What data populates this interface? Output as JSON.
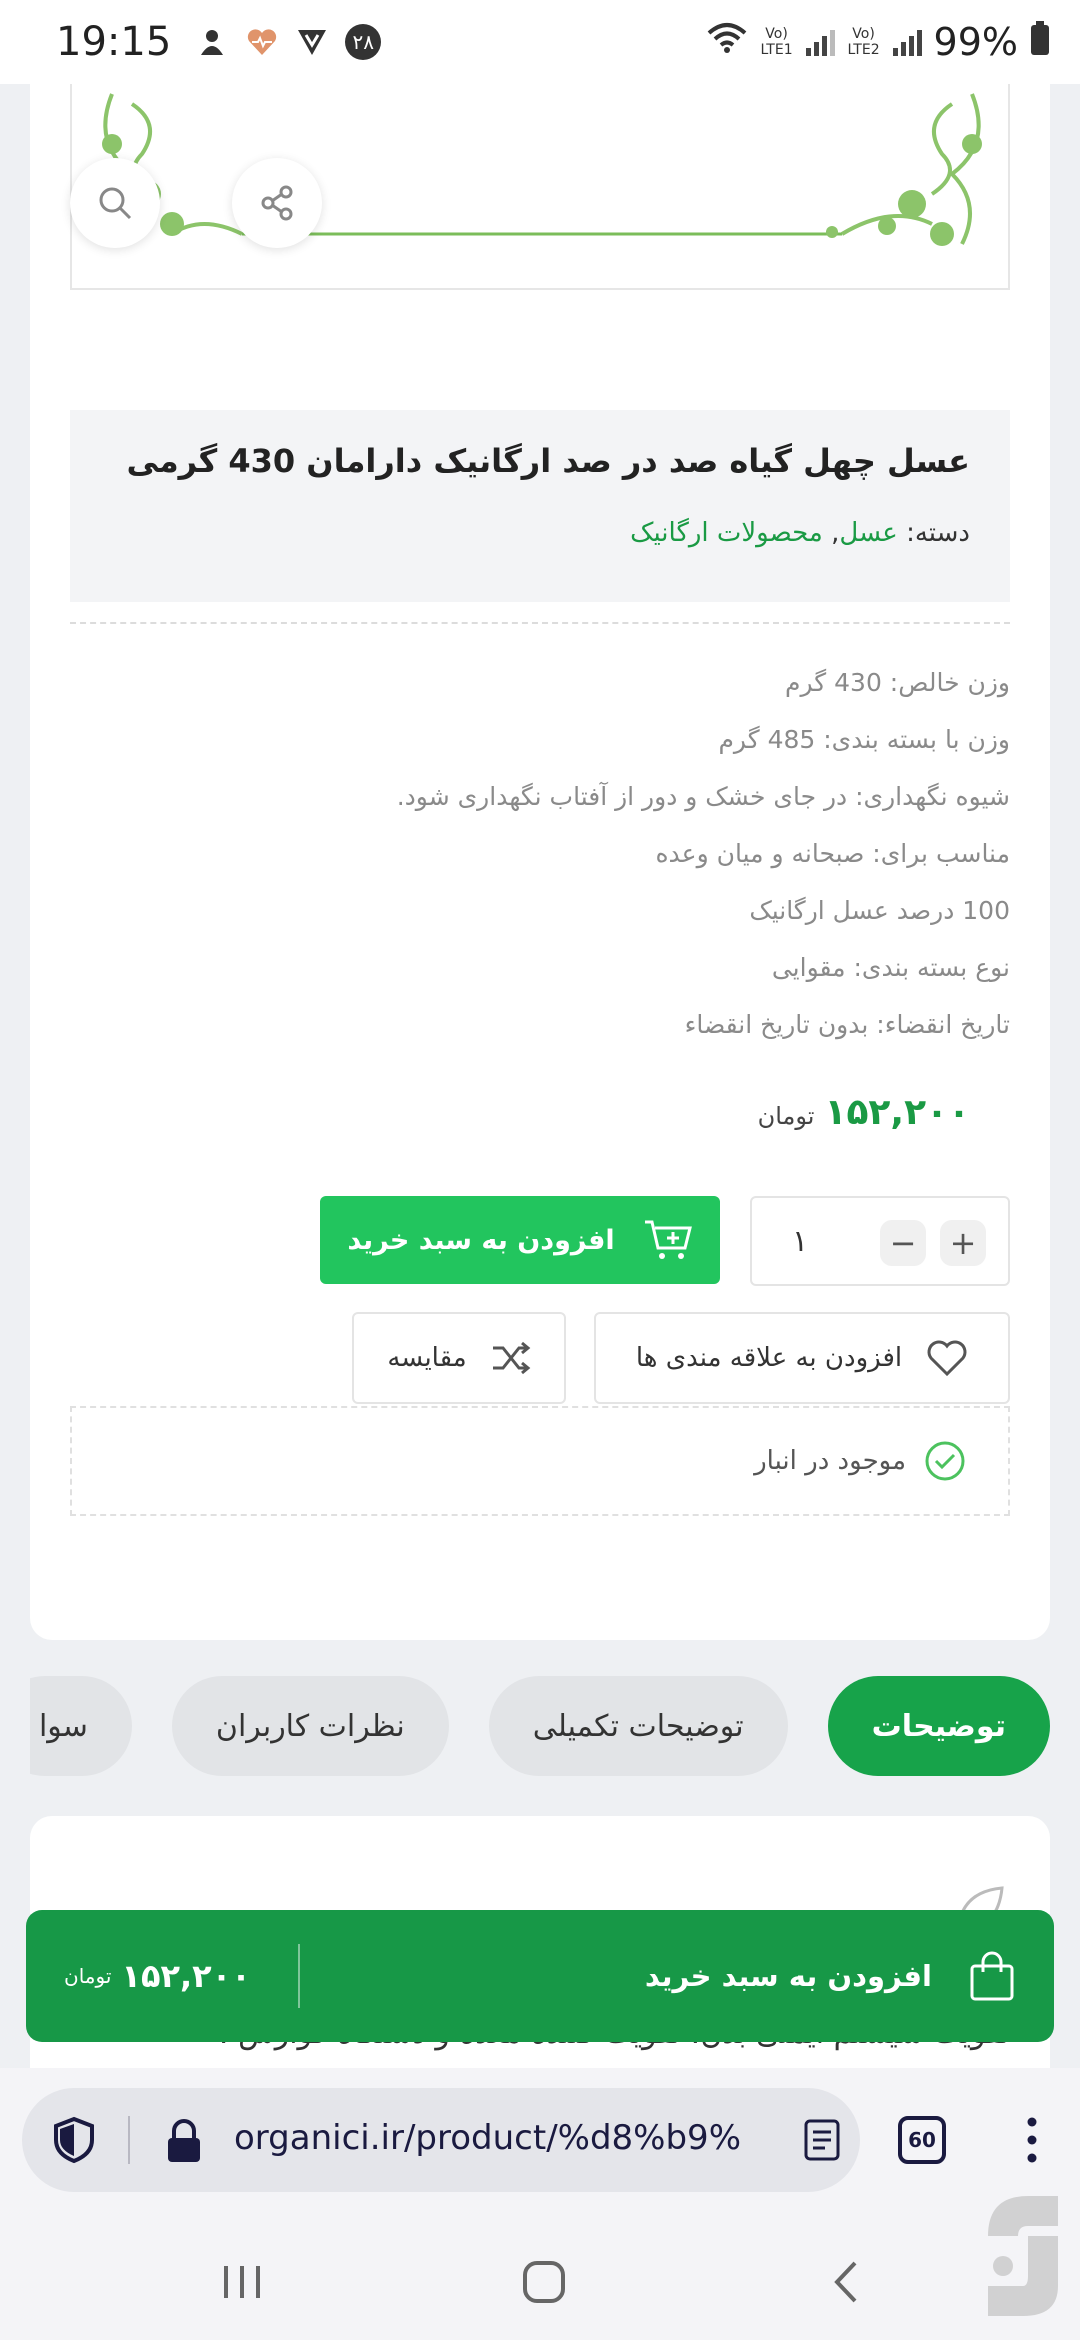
{
  "status_bar": {
    "time": "19:15",
    "notif_badge": "۲۸",
    "lte1": "Vo) LTE1",
    "lte2": "Vo) LTE2",
    "battery": "99%"
  },
  "product": {
    "title": "عسل چهل گیاه صد در صد ارگانیک دارامان 430 گرمی",
    "category_label": "دسته:",
    "categories": [
      "عسل",
      "محصولات ارگانیک"
    ],
    "category_separator": ",",
    "specs": [
      "وزن خالص: 430 گرم",
      "وزن با بسته بندی: 485 گرم",
      "شیوه نگهداری: در جای خشک و دور از آفتاب نگهداری شود.",
      "مناسب برای: صبحانه و میان وعده",
      "100 درصد عسل ارگانیک",
      "نوع بسته بندی: مقوایی",
      "تاریخ انقضاء: بدون تاریخ انقضاء"
    ],
    "price": "۱۵۲,۲۰۰",
    "currency": "تومان",
    "quantity": "۱",
    "add_to_cart_label": "افزودن به سبد خرید",
    "wishlist_label": "افزودن به علاقه مندی ها",
    "compare_label": "مقایسه",
    "stock_label": "موجود در انبار"
  },
  "tabs": [
    {
      "label": "توضیحات",
      "active": true
    },
    {
      "label": "توضیحات تکمیلی",
      "active": false
    },
    {
      "label": "نظرات کاربران",
      "active": false
    },
    {
      "label": "سوا",
      "active": false
    }
  ],
  "description_partial": "تقویت سیستم ایمنی بدن، تقویت کننده معده و دستگاه گوارش ،",
  "sticky_bar": {
    "add_to_cart_label": "افزودن به سبد خرید",
    "price": "۱۵۲,۲۰۰",
    "currency": "تومان"
  },
  "browser": {
    "url": "organici.ir/product/%d8%b9%",
    "tab_count": "60"
  },
  "colors": {
    "accent_green": "#22c55e",
    "dark_green": "#179847",
    "link_green": "#1a9a44"
  }
}
